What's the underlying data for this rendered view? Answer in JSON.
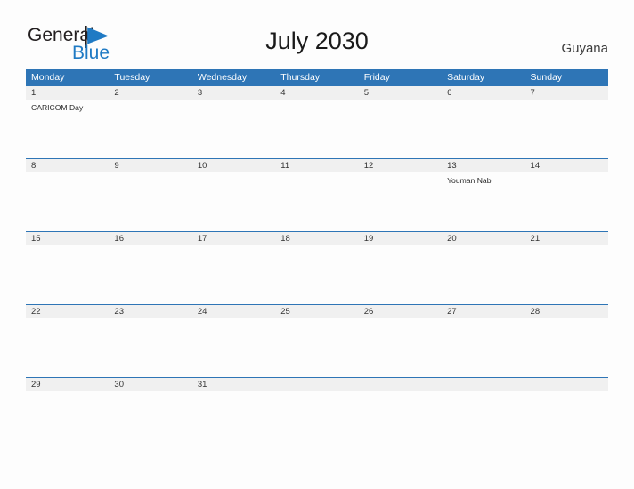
{
  "brand": {
    "name_part1": "General",
    "name_part2": "Blue",
    "flag_icon": "blue-flag-triangle",
    "color_dark": "#231f20",
    "color_blue": "#1f7ac4"
  },
  "header": {
    "title": "July 2030",
    "country": "Guyana"
  },
  "colors": {
    "header_blue": "#2e75b6",
    "date_band_gray": "#f0f0f0",
    "page_background": "#fdfdfd",
    "rule_blue": "#2e75b6"
  },
  "calendar": {
    "weekday_headers": [
      "Monday",
      "Tuesday",
      "Wednesday",
      "Thursday",
      "Friday",
      "Saturday",
      "Sunday"
    ],
    "weeks": [
      {
        "days": [
          {
            "date": "1",
            "events": [
              "CARICOM Day"
            ]
          },
          {
            "date": "2",
            "events": []
          },
          {
            "date": "3",
            "events": []
          },
          {
            "date": "4",
            "events": []
          },
          {
            "date": "5",
            "events": []
          },
          {
            "date": "6",
            "events": []
          },
          {
            "date": "7",
            "events": []
          }
        ]
      },
      {
        "days": [
          {
            "date": "8",
            "events": []
          },
          {
            "date": "9",
            "events": []
          },
          {
            "date": "10",
            "events": []
          },
          {
            "date": "11",
            "events": []
          },
          {
            "date": "12",
            "events": []
          },
          {
            "date": "13",
            "events": [
              "Youman Nabi"
            ]
          },
          {
            "date": "14",
            "events": []
          }
        ]
      },
      {
        "days": [
          {
            "date": "15",
            "events": []
          },
          {
            "date": "16",
            "events": []
          },
          {
            "date": "17",
            "events": []
          },
          {
            "date": "18",
            "events": []
          },
          {
            "date": "19",
            "events": []
          },
          {
            "date": "20",
            "events": []
          },
          {
            "date": "21",
            "events": []
          }
        ]
      },
      {
        "days": [
          {
            "date": "22",
            "events": []
          },
          {
            "date": "23",
            "events": []
          },
          {
            "date": "24",
            "events": []
          },
          {
            "date": "25",
            "events": []
          },
          {
            "date": "26",
            "events": []
          },
          {
            "date": "27",
            "events": []
          },
          {
            "date": "28",
            "events": []
          }
        ]
      },
      {
        "days": [
          {
            "date": "29",
            "events": []
          },
          {
            "date": "30",
            "events": []
          },
          {
            "date": "31",
            "events": []
          },
          {
            "date": "",
            "events": []
          },
          {
            "date": "",
            "events": []
          },
          {
            "date": "",
            "events": []
          },
          {
            "date": "",
            "events": []
          }
        ]
      }
    ]
  }
}
